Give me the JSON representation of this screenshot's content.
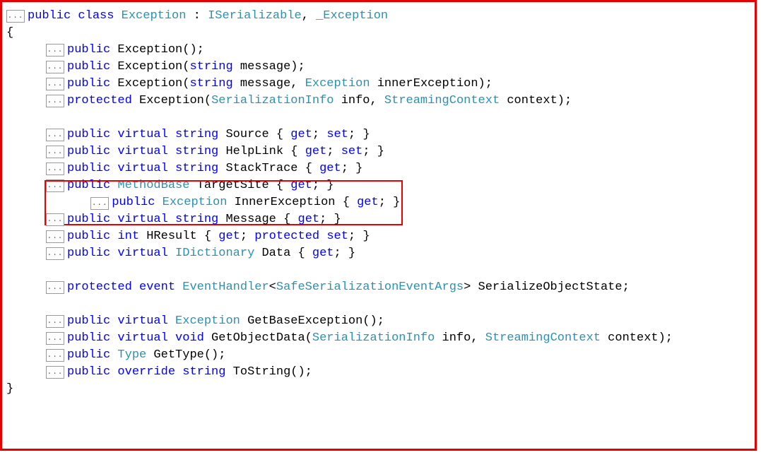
{
  "foldMarker": "...",
  "classLine": {
    "kw1": "public",
    "kw2": "class",
    "type1": "Exception",
    "sep": " : ",
    "type2": "ISerializable",
    "comma": ", ",
    "type3": "_Exception"
  },
  "openBrace": "{",
  "closeBrace": "}",
  "ctors": [
    {
      "access": "public",
      "name": "Exception",
      "sig": "();"
    },
    {
      "access": "public",
      "name": "Exception",
      "sigPre": "(",
      "paramType": "string",
      "paramName": " message);"
    },
    {
      "access": "public",
      "name": "Exception",
      "sigPre": "(",
      "p1t": "string",
      "p1n": " message, ",
      "p2t": "Exception",
      "p2n": " innerException);"
    },
    {
      "access": "protected",
      "name": "Exception",
      "sigPre": "(",
      "p1t": "SerializationInfo",
      "p1n": " info, ",
      "p2t": "StreamingContext",
      "p2n": " context);"
    }
  ],
  "props": [
    {
      "access": "public",
      "virtual": "virtual",
      "type": "string",
      "name": " Source ",
      "acc": "{ get; set; }"
    },
    {
      "access": "public",
      "virtual": "virtual",
      "type": "string",
      "name": " HelpLink ",
      "acc": "{ get; set; }"
    },
    {
      "access": "public",
      "virtual": "virtual",
      "type": "string",
      "name": " StackTrace ",
      "acc": "{ get; }"
    },
    {
      "access": "public",
      "virtual": "",
      "type": "MethodBase",
      "name": " TargetSite ",
      "acc": "{ get; }"
    },
    {
      "access": "public",
      "virtual": "",
      "type": "Exception",
      "name": " InnerException ",
      "acc": "{ get; }",
      "highlight": true
    },
    {
      "access": "public",
      "virtual": "virtual",
      "type": "string",
      "name": " Message ",
      "acc": "{ get; }"
    },
    {
      "access": "public",
      "virtual": "",
      "type": "int",
      "name": " HResult ",
      "acc": "{ get; protected set; }"
    },
    {
      "access": "public",
      "virtual": "virtual",
      "type": "IDictionary",
      "name": " Data ",
      "acc": "{ get; }"
    }
  ],
  "event": {
    "access": "protected",
    "kw": "event",
    "type": "EventHandler",
    "generic": "SafeSerializationEventArgs",
    "name": " SerializeObjectState;"
  },
  "methods": [
    {
      "access": "public",
      "mod": "virtual",
      "ret": "Exception",
      "name": " GetBaseException();"
    },
    {
      "access": "public",
      "mod": "virtual",
      "ret": "void",
      "name": " GetObjectData(",
      "p1t": "SerializationInfo",
      "p1n": " info, ",
      "p2t": "StreamingContext",
      "p2n": " context);"
    },
    {
      "access": "public",
      "mod": "",
      "ret": "Type",
      "name": " GetType();"
    },
    {
      "access": "public",
      "mod": "override",
      "ret": "string",
      "name": " ToString();"
    }
  ]
}
